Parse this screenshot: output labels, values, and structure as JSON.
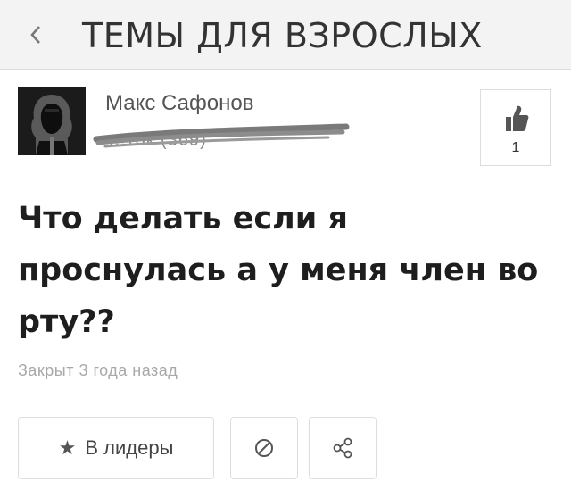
{
  "header": {
    "back_icon": "chevron-left-icon",
    "title": "ТЕМЫ ДЛЯ ВЗРОСЛЫХ"
  },
  "author": {
    "name": "Макс Сафонов",
    "rank": "...ток (369)",
    "avatar_icon": "hooded-figure-avatar"
  },
  "like": {
    "icon": "thumbs-up-icon",
    "count": "1"
  },
  "post": {
    "question": "Что делать если я проснулась а у меня член во рту??",
    "status": "Закрыт 3 года назад"
  },
  "actions": {
    "leaders_icon": "star-icon",
    "leaders_label": "В лидеры",
    "block_icon": "block-icon",
    "share_icon": "share-icon"
  },
  "colors": {
    "header_bg": "#f3f3f3",
    "text_dark": "#1e1e1e",
    "text_muted": "#a8a8a8"
  }
}
